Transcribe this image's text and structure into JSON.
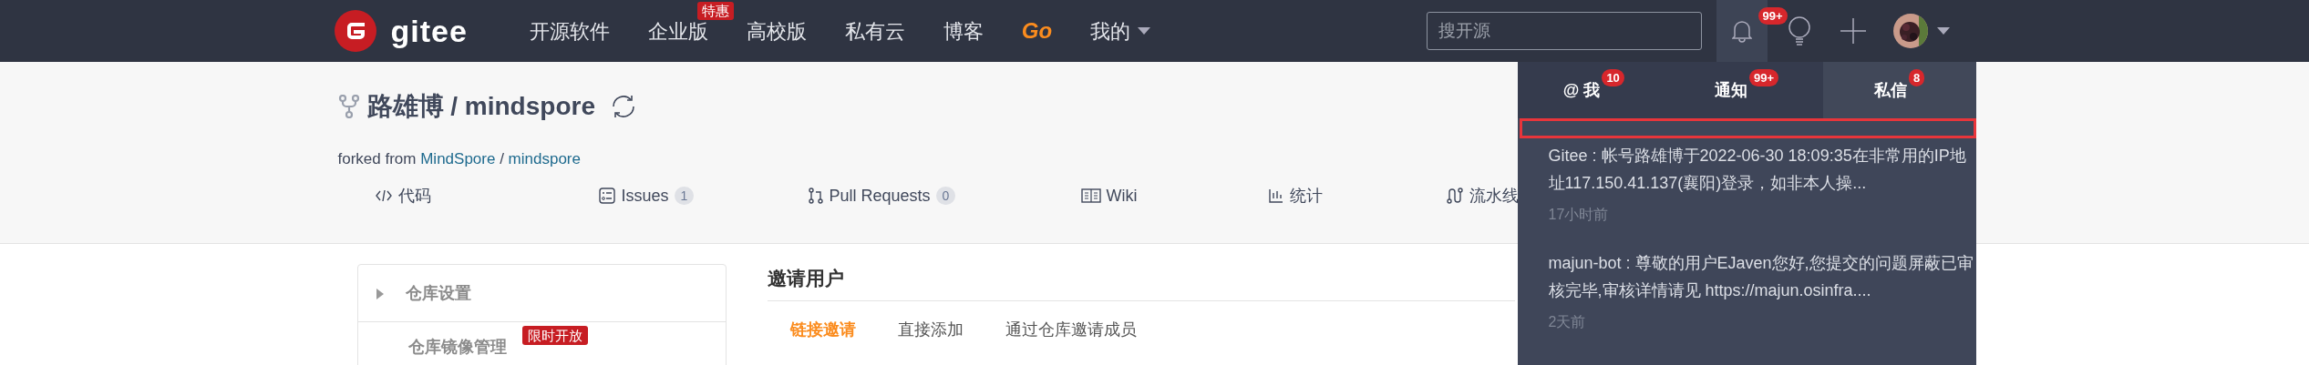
{
  "navbar": {
    "logo": "gitee",
    "items": [
      {
        "label": "开源软件",
        "kind": "link"
      },
      {
        "label": "企业版",
        "kind": "link",
        "badge": "特惠"
      },
      {
        "label": "高校版",
        "kind": "link"
      },
      {
        "label": "私有云",
        "kind": "link"
      },
      {
        "label": "博客",
        "kind": "link"
      },
      {
        "label": "Go",
        "kind": "brand"
      },
      {
        "label": "我的",
        "kind": "menu"
      }
    ],
    "search": {
      "placeholder": "搜开源"
    },
    "notification_badge": "99+"
  },
  "repo": {
    "owner": "路雄博",
    "separator": "/",
    "name": "mindspore",
    "forked_label": "forked from",
    "source_owner": "MindSpore",
    "source_separator": "/",
    "source_name": "mindspore"
  },
  "repo_tabs": [
    {
      "label": "代码"
    },
    {
      "label": "Issues",
      "count": "1"
    },
    {
      "label": "Pull Requests",
      "count": "0"
    },
    {
      "label": "Wiki"
    },
    {
      "label": "统计"
    },
    {
      "label": "流水线"
    }
  ],
  "sidebar": {
    "items": [
      {
        "label": "仓库设置",
        "expandable": true
      },
      {
        "label": "仓库镜像管理",
        "expandable": false,
        "badge": "限时开放"
      }
    ]
  },
  "main": {
    "title": "邀请用户",
    "tabs": [
      {
        "label": "链接邀请",
        "selected": true
      },
      {
        "label": "直接添加",
        "selected": false
      },
      {
        "label": "通过仓库邀请成员",
        "selected": false
      }
    ]
  },
  "notifications": {
    "tabs": [
      {
        "label": "@ 我",
        "count": "10",
        "selected": false
      },
      {
        "label": "通知",
        "count": "99+",
        "selected": false
      },
      {
        "label": "私信",
        "count": "8",
        "selected": true
      }
    ],
    "messages": [
      {
        "text": "Gitee : 帐号路雄博于2022-06-30 18:09:35在非常用的IP地址117.150.41.137(襄阳)登录，如非本人操...",
        "time": "17小时前"
      },
      {
        "text": "majun-bot : 尊敬的用户EJaven您好,您提交的问题屏蔽已审核完毕,审核详情请见 https://majun.osinfra....",
        "time": "2天前"
      }
    ]
  }
}
